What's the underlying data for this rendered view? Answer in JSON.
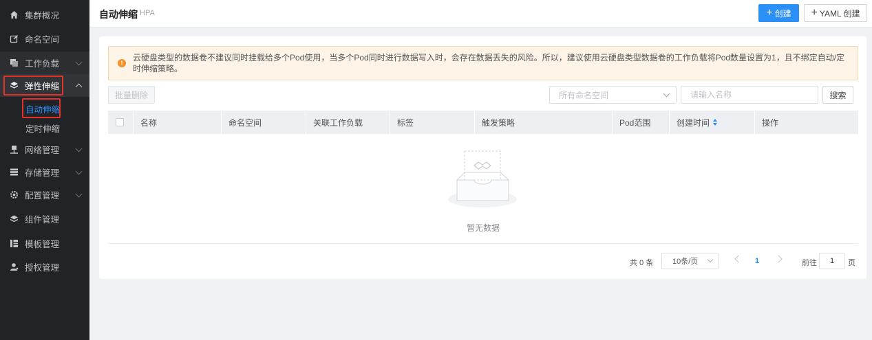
{
  "sidebar": {
    "items": [
      {
        "label": "集群概况",
        "icon": "home-icon"
      },
      {
        "label": "命名空间",
        "icon": "edit-icon"
      },
      {
        "label": "工作负载",
        "icon": "copy-icon"
      },
      {
        "label": "弹性伸缩",
        "icon": "scale-icon"
      },
      {
        "label": "网络管理",
        "icon": "network-icon"
      },
      {
        "label": "存储管理",
        "icon": "storage-icon"
      },
      {
        "label": "配置管理",
        "icon": "gear-icon"
      },
      {
        "label": "组件管理",
        "icon": "layers-icon"
      },
      {
        "label": "模板管理",
        "icon": "template-icon"
      },
      {
        "label": "授权管理",
        "icon": "user-icon"
      }
    ],
    "sub_items": [
      "自动伸缩",
      "定时伸缩"
    ]
  },
  "header": {
    "title": "自动伸缩",
    "subtitle": "HPA",
    "create_label": "创建",
    "yaml_create_label": "YAML 创建"
  },
  "alert": {
    "text": "云硬盘类型的数据卷不建议同时挂载给多个Pod使用，当多个Pod同时进行数据写入时，会存在数据丢失的风险。所以，建议使用云硬盘类型数据卷的工作负载将Pod数量设置为1，且不绑定自动/定时伸缩策略。"
  },
  "toolbar": {
    "batch_delete_label": "批量删除",
    "namespace_placeholder": "所有命名空间",
    "name_placeholder": "请输入名称",
    "search_label": "搜索"
  },
  "table": {
    "columns": [
      "名称",
      "命名空间",
      "关联工作负载",
      "标签",
      "触发策略",
      "Pod范围",
      "创建时间",
      "操作"
    ],
    "empty_text": "暂无数据"
  },
  "pagination": {
    "total_label": "共 0 条",
    "page_size": "10条/页",
    "current_page": "1",
    "goto_label": "前往",
    "goto_value": "1",
    "goto_suffix": "页"
  },
  "colors": {
    "sidebar_bg": "#222326",
    "accent": "#2a8ff7",
    "highlight_border": "#e5322d",
    "alert_bg": "#fdf3e7",
    "alert_icon": "#f2922a"
  }
}
